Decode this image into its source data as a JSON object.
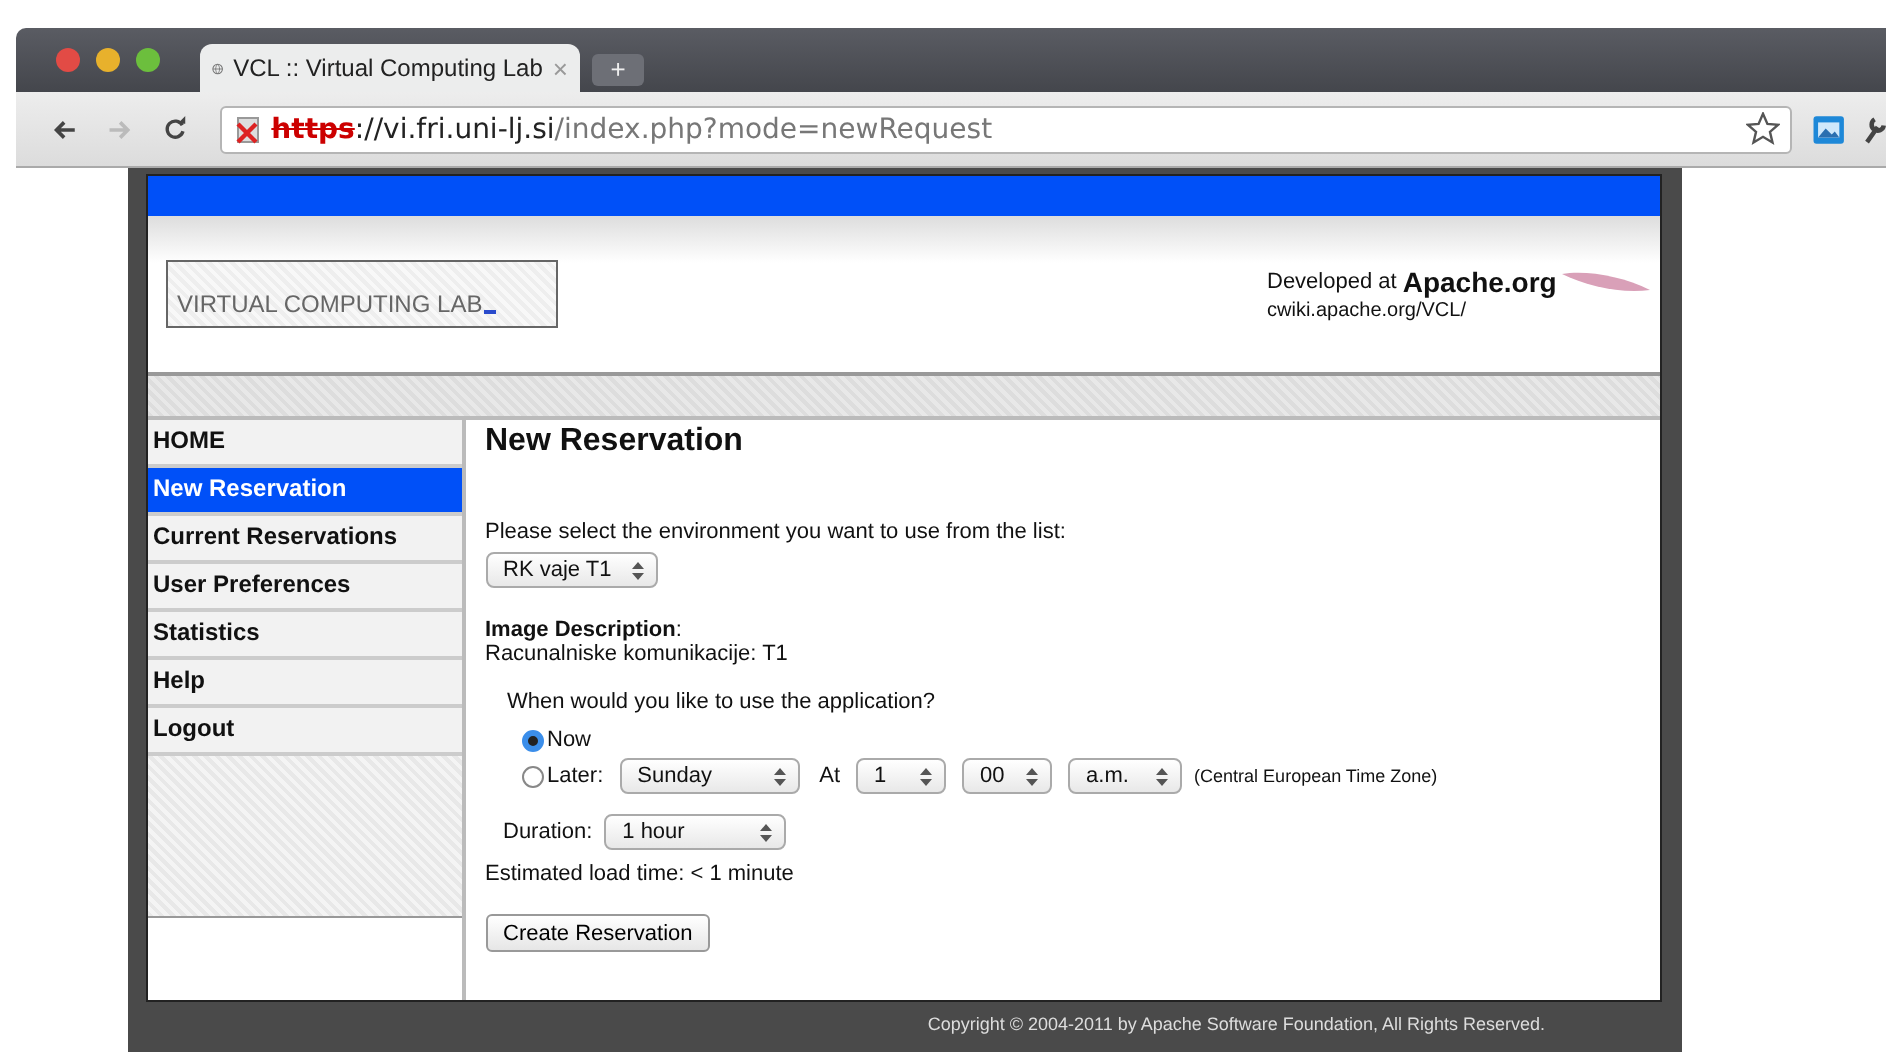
{
  "browser": {
    "tabs": [
      {
        "title": "VCL :: Virtual Computing Lab",
        "close": "×",
        "selected": true
      }
    ],
    "new_tab": "+",
    "url": {
      "scheme": "https",
      "rest": "://vi.fri.uni-lj.si",
      "path": "/index.php?mode=newRequest"
    }
  },
  "header": {
    "logo": "VIRTUAL COMPUTING LAB",
    "developed_at": "Developed at",
    "developer": "Apache.org",
    "link": "cwiki.apache.org/VCL/"
  },
  "sidebar": {
    "items": [
      {
        "label": "HOME",
        "selected": false
      },
      {
        "label": "New Reservation",
        "selected": true
      },
      {
        "label": "Current Reservations",
        "selected": false
      },
      {
        "label": "User Preferences",
        "selected": false
      },
      {
        "label": "Statistics",
        "selected": false
      },
      {
        "label": "Help",
        "selected": false
      },
      {
        "label": "Logout",
        "selected": false
      }
    ]
  },
  "main": {
    "title": "New Reservation",
    "prompt": "Please select the environment you want to use from the list:",
    "environment": "RK vaje T1",
    "image_description_label": "Image Description",
    "image_description_colon": ":",
    "image_description": "Racunalniske komunikacije: T1",
    "when_question": "When would you like to use the application?",
    "options": [
      {
        "label": "Now",
        "selected": true
      },
      {
        "label": "Later:",
        "selected": false
      }
    ],
    "later": {
      "day": "Sunday",
      "at": "At",
      "hour": "1",
      "minute": "00",
      "ampm": "a.m.",
      "timezone": "(Central European Time Zone)"
    },
    "duration_label": "Duration:",
    "duration": "1 hour",
    "load_time": "Estimated load time: < 1 minute",
    "submit": "Create Reservation"
  },
  "footer": {
    "copyright": "Copyright © 2004-2011 by Apache Software Foundation, All Rights Reserved."
  }
}
